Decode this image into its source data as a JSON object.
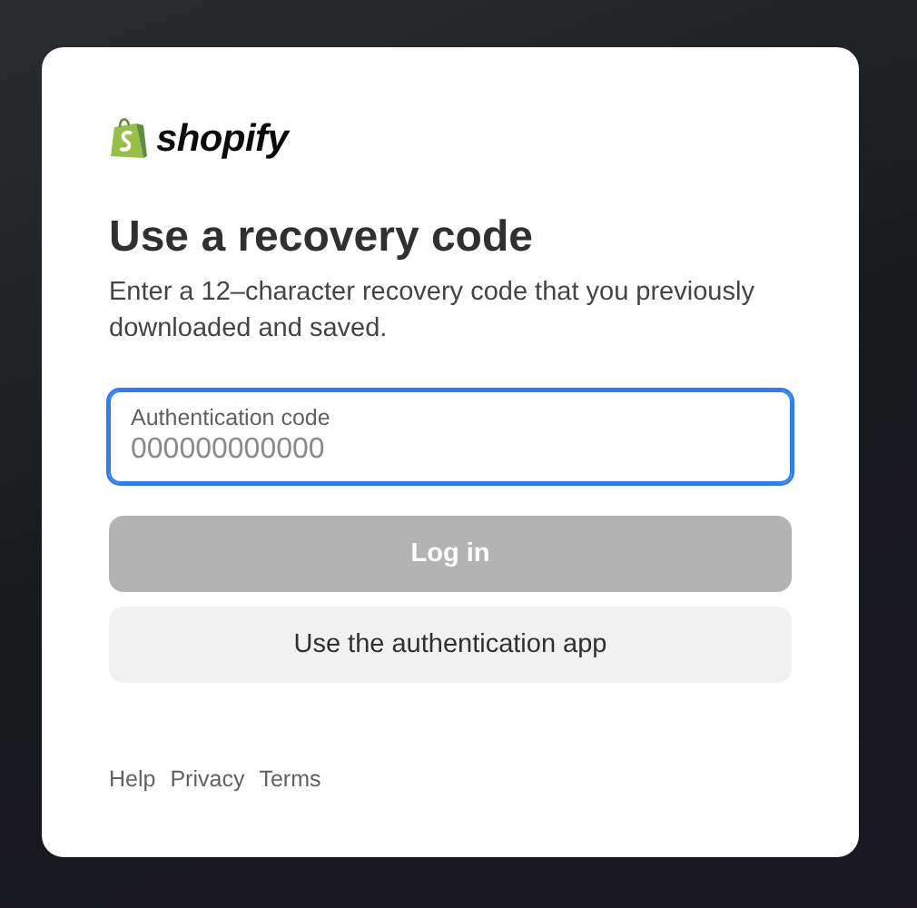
{
  "brand": {
    "name": "shopify"
  },
  "heading": "Use a recovery code",
  "description": "Enter a 12–character recovery code that you previously downloaded and saved.",
  "field": {
    "label": "Authentication code",
    "placeholder": "000000000000",
    "focused": true
  },
  "buttons": [
    {
      "label": "Log in",
      "kind": "primary",
      "disabled": true
    },
    {
      "label": "Use the authentication app",
      "kind": "secondary",
      "disabled": false
    }
  ],
  "footer_links": [
    "Help",
    "Privacy",
    "Terms"
  ]
}
